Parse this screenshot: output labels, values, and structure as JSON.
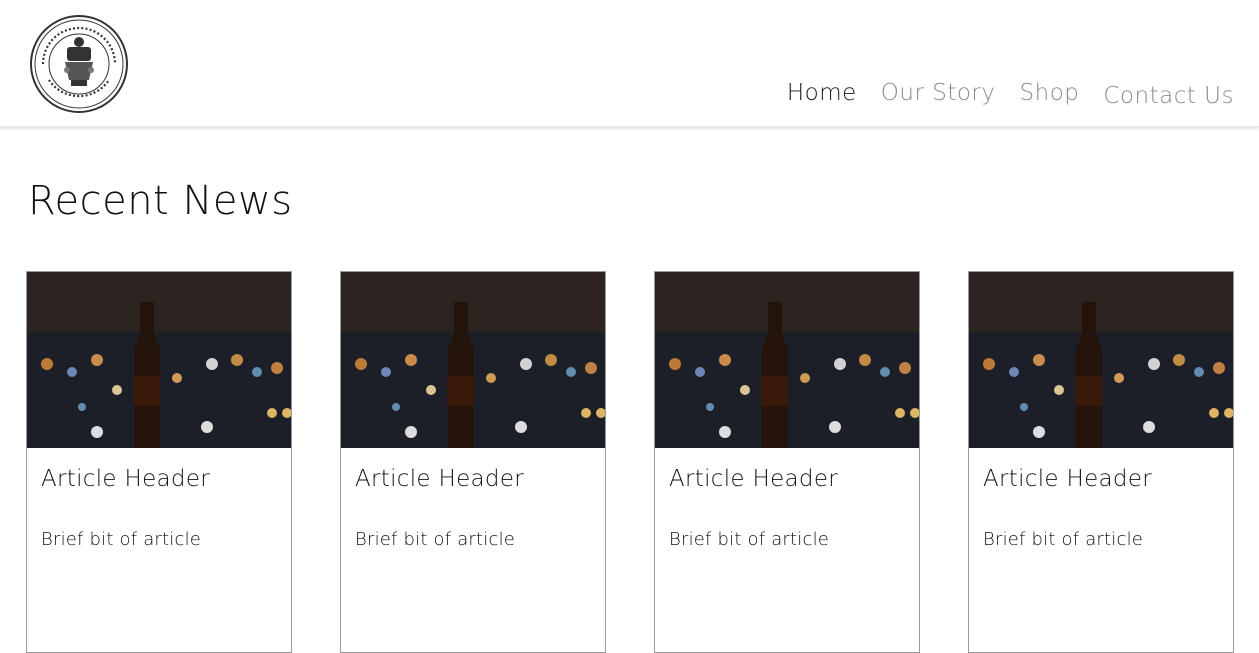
{
  "brand": {
    "logo_icon": "brewery-seal-logo-icon",
    "seal_text": "GEORGE SHAW BREWERY CO. LTD LEIGH, LANCS"
  },
  "nav": {
    "items": [
      {
        "label": "Home",
        "active": true
      },
      {
        "label": "Our Story",
        "active": false
      },
      {
        "label": "Shop",
        "active": false
      },
      {
        "label": "Contact Us",
        "active": false
      }
    ]
  },
  "main": {
    "section_title": "Recent News",
    "articles": [
      {
        "title": "Article Header",
        "excerpt": "Brief bit of article",
        "image_icon": "beer-bottle-night-photo"
      },
      {
        "title": "Article Header",
        "excerpt": "Brief bit of article",
        "image_icon": "beer-bottle-night-photo"
      },
      {
        "title": "Article Header",
        "excerpt": "Brief bit of article",
        "image_icon": "beer-bottle-night-photo"
      },
      {
        "title": "Article Header",
        "excerpt": "Brief bit of article",
        "image_icon": "beer-bottle-night-photo"
      }
    ]
  },
  "colors": {
    "nav_active": "#1a1a1a",
    "nav_inactive": "#8a8a8a",
    "card_border": "#9a9a9a"
  }
}
